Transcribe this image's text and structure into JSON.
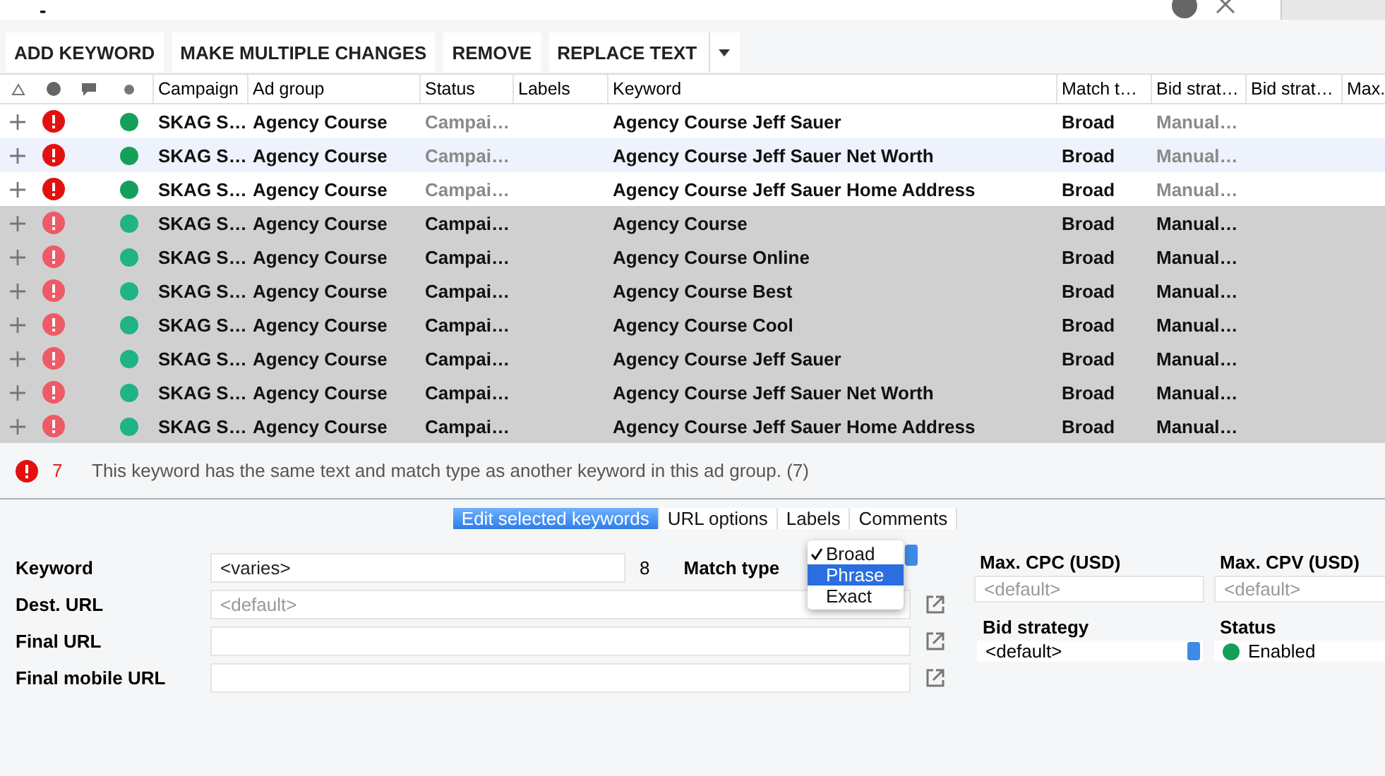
{
  "search": {
    "value": "-"
  },
  "toolbar": [
    {
      "label": "ADD KEYWORD",
      "kind": "button"
    },
    {
      "label": "MAKE MULTIPLE CHANGES",
      "kind": "button"
    },
    {
      "label": "REMOVE",
      "kind": "button"
    },
    {
      "label": "REPLACE TEXT",
      "kind": "split"
    }
  ],
  "table": {
    "columns": [
      "Campaign",
      "Ad group",
      "Status",
      "Labels",
      "Keyword",
      "Match t…",
      "Bid strat…",
      "Bid strat…",
      "Max."
    ],
    "rows": [
      {
        "selected": false,
        "hovered": false,
        "campaign": "SKAG S…",
        "ad_group": "Agency Course",
        "status": "Campai…",
        "keyword": "Agency Course Jeff Sauer",
        "match": "Broad",
        "bid": "Manual…"
      },
      {
        "selected": false,
        "hovered": true,
        "campaign": "SKAG S…",
        "ad_group": "Agency Course",
        "status": "Campai…",
        "keyword": "Agency Course Jeff Sauer Net Worth",
        "match": "Broad",
        "bid": "Manual…"
      },
      {
        "selected": false,
        "hovered": false,
        "campaign": "SKAG S…",
        "ad_group": "Agency Course",
        "status": "Campai…",
        "keyword": "Agency Course Jeff Sauer Home Address",
        "match": "Broad",
        "bid": "Manual…"
      },
      {
        "selected": true,
        "hovered": false,
        "campaign": "SKAG S…",
        "ad_group": "Agency Course",
        "status": "Campai…",
        "keyword": "Agency Course",
        "match": "Broad",
        "bid": "Manual…"
      },
      {
        "selected": true,
        "hovered": false,
        "campaign": "SKAG S…",
        "ad_group": "Agency Course",
        "status": "Campai…",
        "keyword": "Agency Course Online",
        "match": "Broad",
        "bid": "Manual…"
      },
      {
        "selected": true,
        "hovered": false,
        "campaign": "SKAG S…",
        "ad_group": "Agency Course",
        "status": "Campai…",
        "keyword": "Agency Course Best",
        "match": "Broad",
        "bid": "Manual…"
      },
      {
        "selected": true,
        "hovered": false,
        "campaign": "SKAG S…",
        "ad_group": "Agency Course",
        "status": "Campai…",
        "keyword": "Agency Course Cool",
        "match": "Broad",
        "bid": "Manual…"
      },
      {
        "selected": true,
        "hovered": false,
        "campaign": "SKAG S…",
        "ad_group": "Agency Course",
        "status": "Campai…",
        "keyword": "Agency Course Jeff Sauer",
        "match": "Broad",
        "bid": "Manual…"
      },
      {
        "selected": true,
        "hovered": false,
        "campaign": "SKAG S…",
        "ad_group": "Agency Course",
        "status": "Campai…",
        "keyword": "Agency Course Jeff Sauer Net Worth",
        "match": "Broad",
        "bid": "Manual…"
      },
      {
        "selected": true,
        "hovered": false,
        "campaign": "SKAG S…",
        "ad_group": "Agency Course",
        "status": "Campai…",
        "keyword": "Agency Course Jeff Sauer Home Address",
        "match": "Broad",
        "bid": "Manual…"
      }
    ]
  },
  "error_bar": {
    "count": "7",
    "message": "This keyword has the same text and match type as another keyword in this ad group. (7)"
  },
  "tabs": [
    {
      "label": "Edit selected keywords",
      "selected": true
    },
    {
      "label": "URL options",
      "selected": false
    },
    {
      "label": "Labels",
      "selected": false
    },
    {
      "label": "Comments",
      "selected": false
    }
  ],
  "form": {
    "keyword": {
      "label": "Keyword",
      "value": "<varies>",
      "count": "8"
    },
    "match_type": {
      "label": "Match type",
      "options": [
        {
          "label": "Broad",
          "checked": true,
          "selected": false
        },
        {
          "label": "Phrase",
          "checked": false,
          "selected": true
        },
        {
          "label": "Exact",
          "checked": false,
          "selected": false
        }
      ]
    },
    "dest_url": {
      "label": "Dest. URL",
      "placeholder": "<default>"
    },
    "final_url": {
      "label": "Final URL"
    },
    "final_mobile_url": {
      "label": "Final mobile URL"
    },
    "max_cpc": {
      "label": "Max. CPC (USD)",
      "placeholder": "<default>"
    },
    "max_cpv": {
      "label": "Max. CPV (USD)",
      "placeholder": "<default>"
    },
    "bid_strategy": {
      "label": "Bid strategy",
      "value": "<default>"
    },
    "status": {
      "label": "Status",
      "value": "Enabled"
    }
  }
}
